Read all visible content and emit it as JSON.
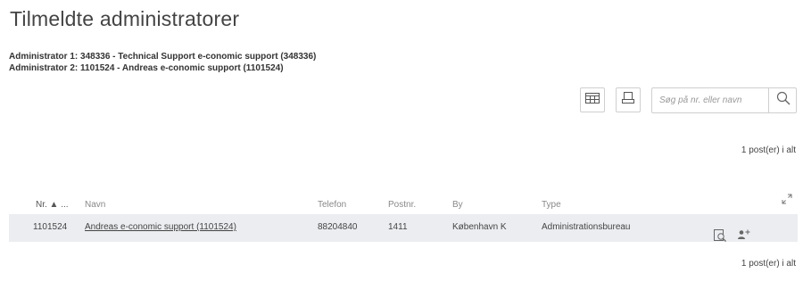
{
  "page": {
    "title": "Tilmeldte administratorer",
    "admin1": "Administrator 1: 348336 - Technical Support e-conomic support (348336)",
    "admin2": "Administrator 2: 1101524 - Andreas e-conomic support (1101524)"
  },
  "search": {
    "placeholder": "Søg på nr. eller navn",
    "value": ""
  },
  "table": {
    "count_top": "1 post(er) i alt",
    "count_bottom": "1 post(er) i alt",
    "columns": {
      "nr": "Nr. ▲ ...",
      "navn": "Navn",
      "telefon": "Telefon",
      "postnr": "Postnr.",
      "by": "By",
      "type": "Type"
    },
    "rows": [
      {
        "nr": "1101524",
        "navn": "Andreas e-conomic support (1101524)",
        "telefon": "88204840",
        "postnr": "1411",
        "by": "København K",
        "type": "Administrationsbureau"
      }
    ]
  },
  "icons": {
    "columns": "columns-icon",
    "print": "print-icon",
    "search": "search-icon",
    "expand": "expand-icon",
    "preview": "preview-icon",
    "add_user": "add-user-icon"
  }
}
